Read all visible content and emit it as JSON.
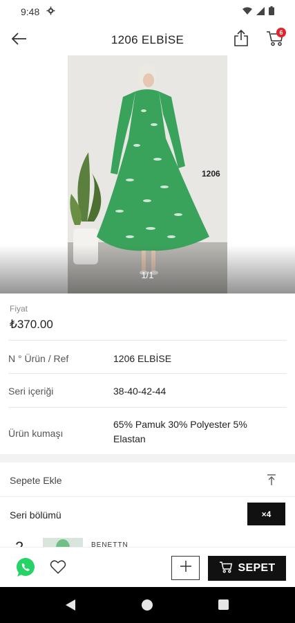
{
  "status_bar": {
    "time": "9:48",
    "icons": [
      "settings-gear-icon",
      "wifi-icon",
      "signal-icon",
      "battery-icon"
    ]
  },
  "app_bar": {
    "title": "1206 ELBİSE",
    "cart_count": "6",
    "icons": {
      "back": "arrow-left-icon",
      "share": "share-icon",
      "cart": "cart-icon"
    }
  },
  "gallery": {
    "image_label": "1206",
    "page_indicator": "1/1"
  },
  "product": {
    "price_label": "Fiyat",
    "price": "₺370.00",
    "rows": [
      {
        "label": "N ° Ürün / Ref",
        "value": "1206 ELBİSE"
      },
      {
        "label": "Seri içeriği",
        "value": "38-40-42-44"
      },
      {
        "label": "Ürün kumaşı",
        "value": "65% Pamuk 30% Polyester 5% Elastan"
      }
    ]
  },
  "cart_section": {
    "title": "Sepete Ekle",
    "seri_label": "Seri bölümü",
    "qty_chip": "×4"
  },
  "bottom_bar": {
    "sepet_label": "SEPET",
    "colors": {
      "whatsapp": "#25d366",
      "button": "#111111"
    }
  },
  "colors": {
    "badge": "#e0242c",
    "accent": "#111111"
  }
}
